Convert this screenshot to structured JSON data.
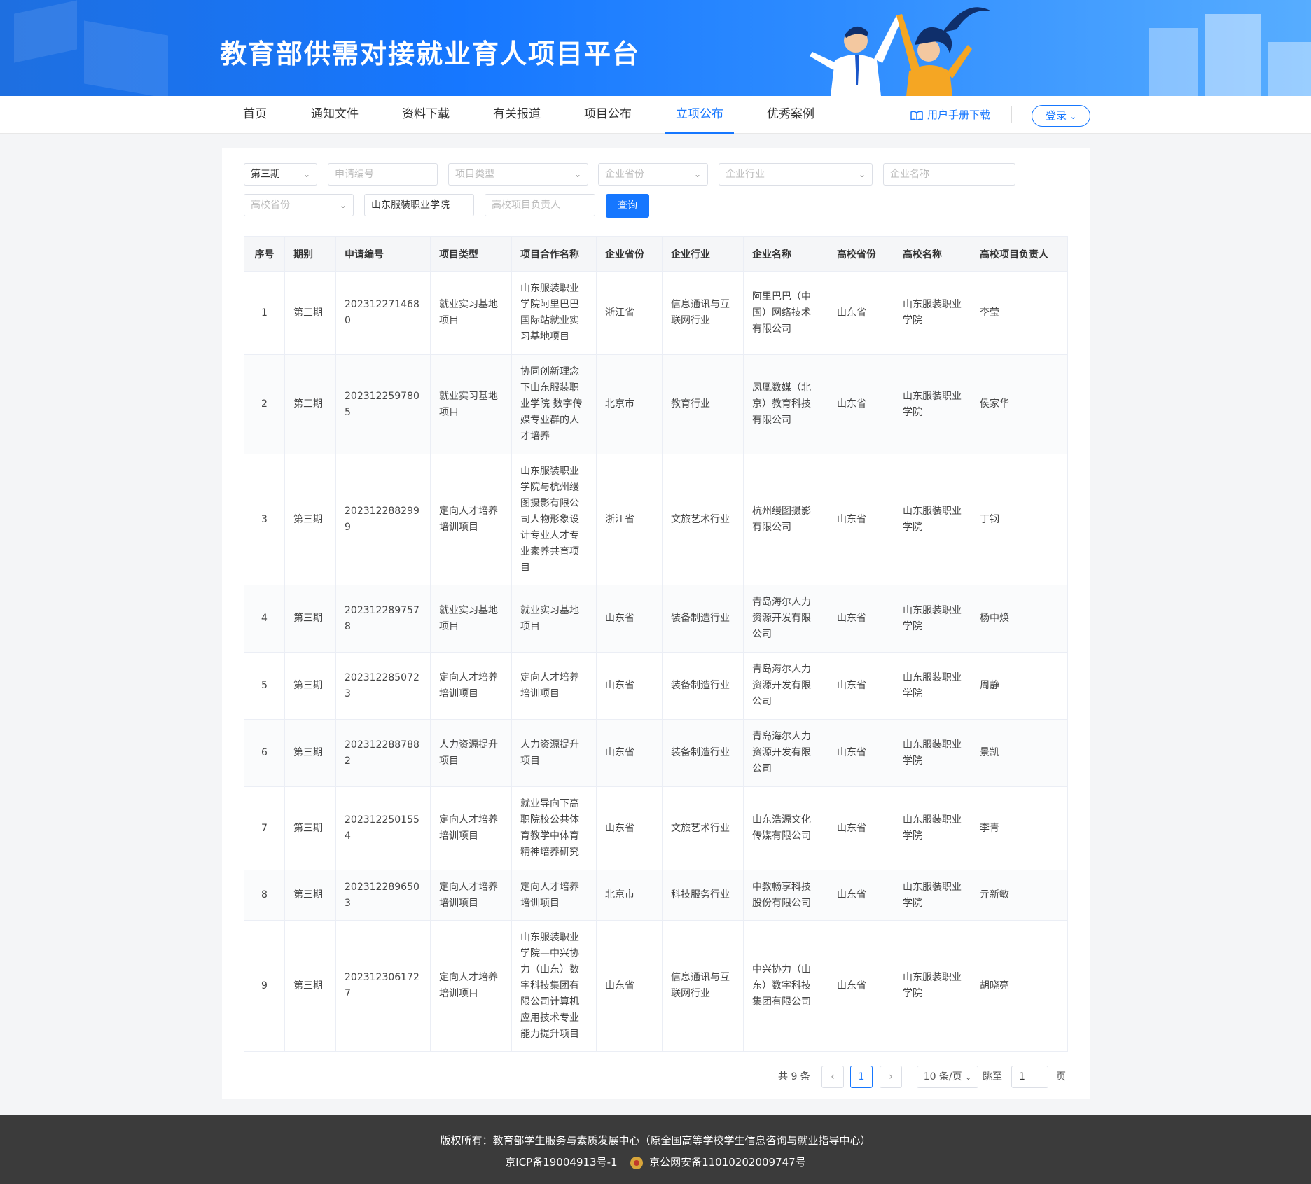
{
  "header": {
    "title": "教育部供需对接就业育人项目平台"
  },
  "nav": {
    "items": [
      "首页",
      "通知文件",
      "资料下载",
      "有关报道",
      "项目公布",
      "立项公布",
      "优秀案例"
    ],
    "active_index": 5,
    "manual_label": "用户手册下载",
    "login_label": "登录"
  },
  "filters": {
    "period_value": "第三期",
    "apply_no_placeholder": "申请编号",
    "project_type_placeholder": "项目类型",
    "company_province_placeholder": "企业省份",
    "company_industry_placeholder": "企业行业",
    "company_name_placeholder": "企业名称",
    "school_province_placeholder": "高校省份",
    "school_name_value": "山东服装职业学院",
    "school_leader_placeholder": "高校项目负责人",
    "query_label": "查询"
  },
  "table": {
    "columns": [
      "序号",
      "期别",
      "申请编号",
      "项目类型",
      "项目合作名称",
      "企业省份",
      "企业行业",
      "企业名称",
      "高校省份",
      "高校名称",
      "高校项目负责人"
    ],
    "rows": [
      [
        "1",
        "第三期",
        "2023122714680",
        "就业实习基地项目",
        "山东服装职业学院阿里巴巴国际站就业实习基地项目",
        "浙江省",
        "信息通讯与互联网行业",
        "阿里巴巴（中国）网络技术有限公司",
        "山东省",
        "山东服装职业学院",
        "李莹"
      ],
      [
        "2",
        "第三期",
        "2023122597805",
        "就业实习基地项目",
        "协同创新理念下山东服装职业学院 数字传媒专业群的人才培养",
        "北京市",
        "教育行业",
        "凤凰数媒（北京）教育科技有限公司",
        "山东省",
        "山东服装职业学院",
        "侯家华"
      ],
      [
        "3",
        "第三期",
        "2023122882999",
        "定向人才培养培训项目",
        "山东服装职业学院与杭州缦图摄影有限公司人物形象设计专业人才专业素养共育项目",
        "浙江省",
        "文旅艺术行业",
        "杭州缦图摄影有限公司",
        "山东省",
        "山东服装职业学院",
        "丁钢"
      ],
      [
        "4",
        "第三期",
        "2023122897578",
        "就业实习基地项目",
        "就业实习基地项目",
        "山东省",
        "装备制造行业",
        "青岛海尔人力资源开发有限公司",
        "山东省",
        "山东服装职业学院",
        "杨中焕"
      ],
      [
        "5",
        "第三期",
        "2023122850723",
        "定向人才培养培训项目",
        "定向人才培养培训项目",
        "山东省",
        "装备制造行业",
        "青岛海尔人力资源开发有限公司",
        "山东省",
        "山东服装职业学院",
        "周静"
      ],
      [
        "6",
        "第三期",
        "2023122887882",
        "人力资源提升项目",
        "人力资源提升项目",
        "山东省",
        "装备制造行业",
        "青岛海尔人力资源开发有限公司",
        "山东省",
        "山东服装职业学院",
        "景凯"
      ],
      [
        "7",
        "第三期",
        "2023122501554",
        "定向人才培养培训项目",
        "就业导向下高职院校公共体育教学中体育精神培养研究",
        "山东省",
        "文旅艺术行业",
        "山东浩源文化传媒有限公司",
        "山东省",
        "山东服装职业学院",
        "李青"
      ],
      [
        "8",
        "第三期",
        "2023122896503",
        "定向人才培养培训项目",
        "定向人才培养培训项目",
        "北京市",
        "科技服务行业",
        "中教畅享科技股份有限公司",
        "山东省",
        "山东服装职业学院",
        "亓新敏"
      ],
      [
        "9",
        "第三期",
        "2023123061727",
        "定向人才培养培训项目",
        "山东服装职业学院—中兴协力（山东）数字科技集团有限公司计算机应用技术专业能力提升项目",
        "山东省",
        "信息通讯与互联网行业",
        "中兴协力（山东）数字科技集团有限公司",
        "山东省",
        "山东服装职业学院",
        "胡晓亮"
      ]
    ]
  },
  "pagination": {
    "total_label": "共 9 条",
    "current_page": "1",
    "prev_symbol": "‹",
    "next_symbol": "›",
    "page_size_label": "10 条/页",
    "jump_label": "跳至",
    "jump_value": "1",
    "page_suffix": "页"
  },
  "footer": {
    "copyright": "版权所有：教育部学生服务与素质发展中心（原全国高等学校学生信息咨询与就业指导中心）",
    "icp": "京ICP备19004913号-1",
    "police": "京公网安备11010202009747号"
  }
}
